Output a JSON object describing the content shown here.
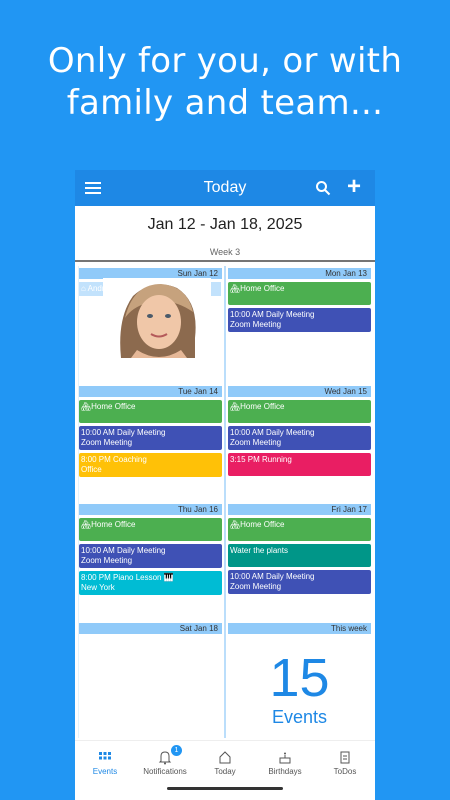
{
  "promo": {
    "line1": "Only for you, or with",
    "line2": "family and team..."
  },
  "appbar": {
    "title": "Today",
    "menu_icon": "hamburger-icon",
    "search_icon": "search-icon",
    "add_icon": "plus-icon",
    "add_label": "+"
  },
  "week_header": {
    "range": "Jan 12 - Jan 18, 2025",
    "week": "Week 3"
  },
  "days": {
    "sun": {
      "header": "Sun Jan 12",
      "person": "Andrea B"
    },
    "mon": {
      "header": "Mon Jan 13",
      "events": [
        "Home Office",
        "10:00 AM Daily Meeting",
        "Zoom Meeting"
      ]
    },
    "tue": {
      "header": "Tue Jan 14",
      "home": "Home Office",
      "meet1": "10:00 AM Daily Meeting",
      "meet2": "Zoom Meeting",
      "coach1": "8:00 PM Coaching",
      "coach2": "Office"
    },
    "wed": {
      "header": "Wed Jan 15",
      "home": "Home Office",
      "meet1": "10:00 AM Daily Meeting",
      "meet2": "Zoom Meeting",
      "run": "3:15 PM Running"
    },
    "thu": {
      "header": "Thu Jan 16",
      "home": "Home Office",
      "meet1": "10:00 AM Daily Meeting",
      "meet2": "Zoom Meeting",
      "piano1": "8:00 PM Piano Lesson 🎹",
      "piano2": "New York"
    },
    "fri": {
      "header": "Fri Jan 17",
      "home": "Home Office",
      "plants": "Water the plants",
      "meet1": "10:00 AM Daily Meeting",
      "meet2": "Zoom Meeting"
    },
    "sat": {
      "header": "Sat Jan 18"
    },
    "this_week": {
      "header": "This week",
      "count": "15",
      "label": "Events"
    }
  },
  "nav": {
    "events": "Events",
    "notifications": "Notifications",
    "notifications_badge": "1",
    "today": "Today",
    "birthdays": "Birthdays",
    "todos": "ToDos"
  },
  "colors": {
    "accent": "#2196F3",
    "appbar": "#1E88E5",
    "green": "#4CAF50",
    "indigo": "#3F51B5",
    "amber": "#FFC107",
    "pink": "#E91E63",
    "teal": "#009688",
    "cyan": "#00BCD4"
  }
}
